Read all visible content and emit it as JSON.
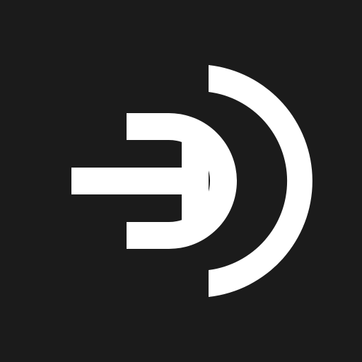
{
  "app_icon": {
    "icon_name": "broadcast-d-logo-icon",
    "colors": {
      "background": "#1b1b1b",
      "foreground": "#ffffff"
    }
  }
}
